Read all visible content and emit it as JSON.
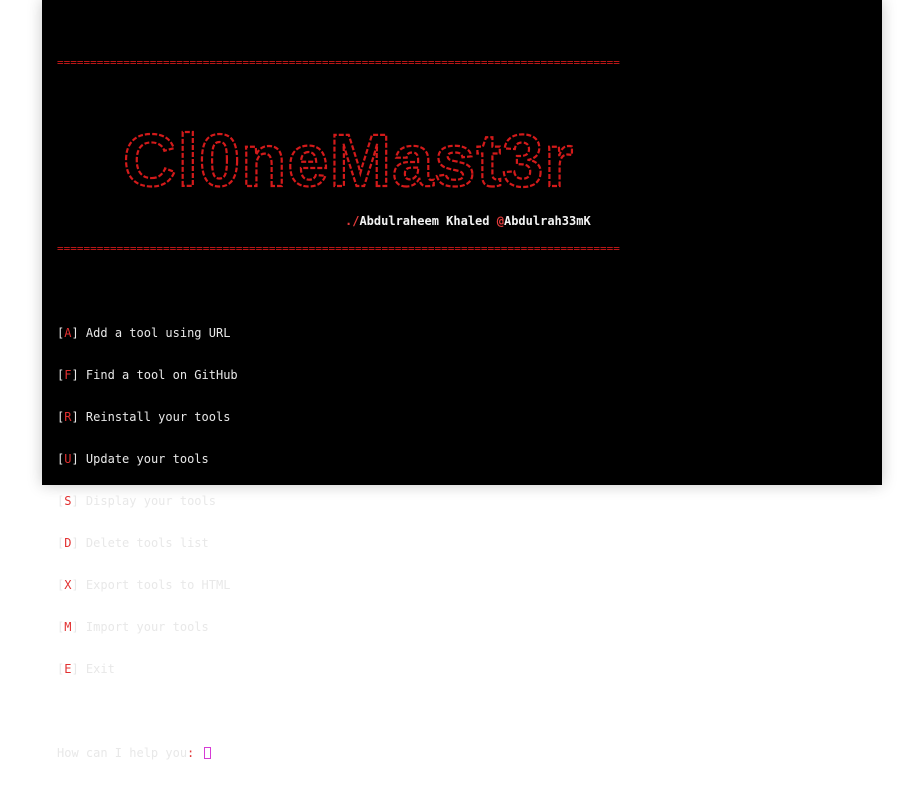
{
  "colors": {
    "background": "#000000",
    "accent_red": "#d31a1a",
    "text": "#e8e8e8",
    "cursor": "#d63bd6"
  },
  "rule": "=====================================================================================",
  "banner_text": "Cl0neMast3r",
  "credit": {
    "prefix": "./",
    "author": "Abdulraheem Khaled ",
    "at": "@",
    "handle": "Abdulrah33mK"
  },
  "menu": [
    {
      "key": "A",
      "label": " Add a tool using URL"
    },
    {
      "key": "F",
      "label": " Find a tool on GitHub"
    },
    {
      "key": "R",
      "label": " Reinstall your tools"
    },
    {
      "key": "U",
      "label": " Update your tools"
    },
    {
      "key": "S",
      "label": " Display your tools"
    },
    {
      "key": "D",
      "label": " Delete tools list"
    },
    {
      "key": "X",
      "label": " Export tools to HTML"
    },
    {
      "key": "M",
      "label": " Import your tools"
    },
    {
      "key": "E",
      "label": " Exit"
    }
  ],
  "prompt": {
    "text": "How can I help you",
    "colon": ": "
  }
}
